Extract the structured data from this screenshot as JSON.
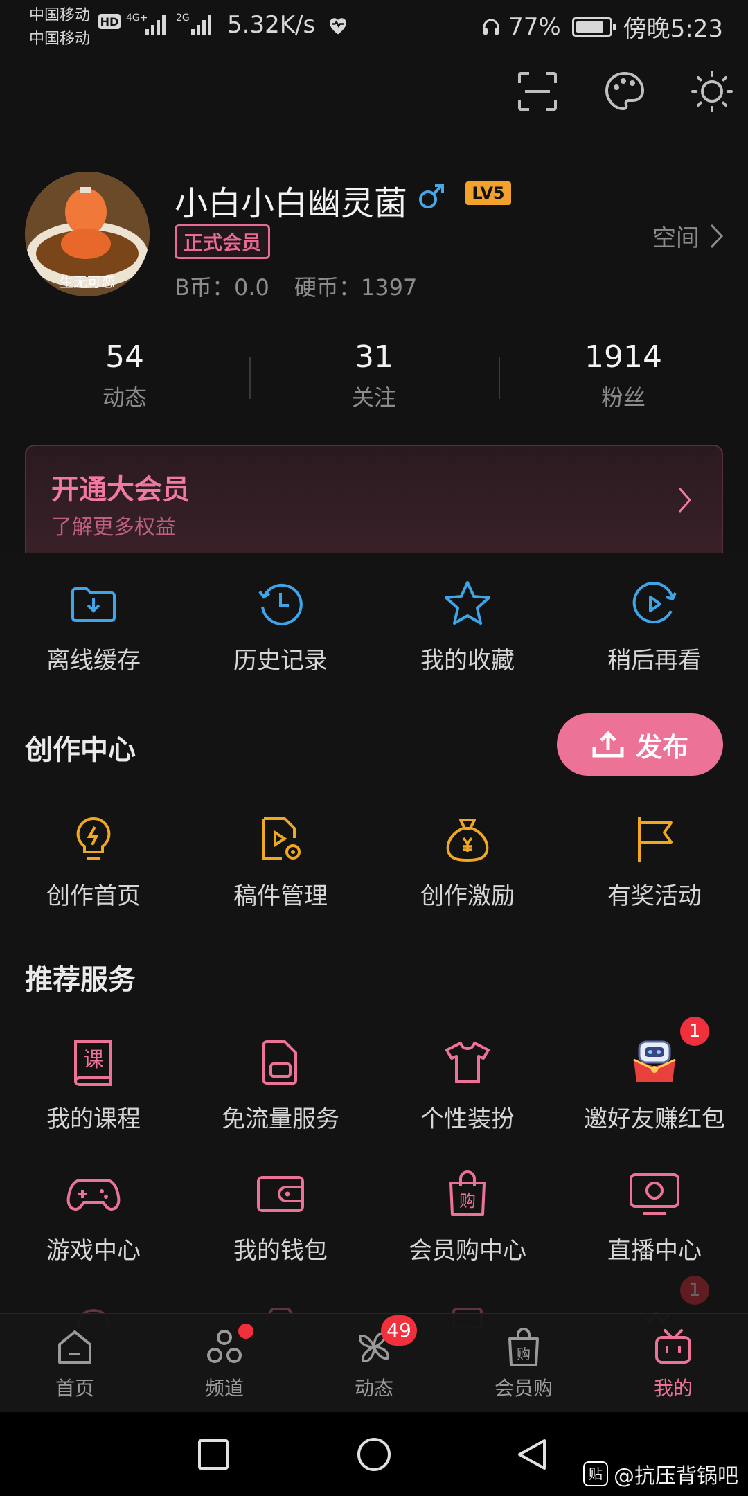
{
  "status_bar": {
    "carrier1": "中国移动",
    "carrier2": "中国移动",
    "hd": "HD",
    "net1": "4G+",
    "net2": "2G",
    "net_speed": "5.32K/s",
    "battery": "77%",
    "time": "傍晚5:23"
  },
  "profile": {
    "avatar_caption": "生无可恋",
    "username": "小白小白幽灵菌",
    "level": "LV5",
    "vip_badge": "正式会员",
    "b_coin": "B币：0.0",
    "hard_coin": "硬币：1397",
    "space_link": "空间"
  },
  "stats": [
    {
      "value": "54",
      "label": "动态"
    },
    {
      "value": "31",
      "label": "关注"
    },
    {
      "value": "1914",
      "label": "粉丝"
    }
  ],
  "vip_card": {
    "title": "开通大会员",
    "subtitle": "了解更多权益"
  },
  "quick_actions": [
    {
      "label": "离线缓存",
      "icon": "download-folder-icon"
    },
    {
      "label": "历史记录",
      "icon": "history-clock-icon"
    },
    {
      "label": "我的收藏",
      "icon": "star-icon"
    },
    {
      "label": "稍后再看",
      "icon": "watch-later-icon"
    }
  ],
  "creation": {
    "title": "创作中心",
    "publish_label": "发布",
    "items": [
      {
        "label": "创作首页",
        "icon": "lightbulb-icon"
      },
      {
        "label": "稿件管理",
        "icon": "manuscript-icon"
      },
      {
        "label": "创作激励",
        "icon": "money-bag-icon"
      },
      {
        "label": "有奖活动",
        "icon": "flag-icon"
      }
    ]
  },
  "services": {
    "title": "推荐服务",
    "row1": [
      {
        "label": "我的课程",
        "icon": "course-book-icon",
        "icon_text": "课"
      },
      {
        "label": "免流量服务",
        "icon": "sim-card-icon"
      },
      {
        "label": "个性装扮",
        "icon": "tshirt-icon"
      },
      {
        "label": "邀好友赚红包",
        "icon": "red-envelope-mascot-icon",
        "badge": "1"
      }
    ],
    "row2": [
      {
        "label": "游戏中心",
        "icon": "gamepad-icon"
      },
      {
        "label": "我的钱包",
        "icon": "wallet-icon"
      },
      {
        "label": "会员购中心",
        "icon": "shopping-bag-icon",
        "icon_text": "购"
      },
      {
        "label": "直播中心",
        "icon": "live-tv-icon"
      }
    ],
    "row3_badge": "1"
  },
  "tab_bar": [
    {
      "label": "首页",
      "icon": "home-icon"
    },
    {
      "label": "频道",
      "icon": "channel-icon"
    },
    {
      "label": "动态",
      "icon": "pinwheel-icon",
      "badge": "49"
    },
    {
      "label": "会员购",
      "icon": "shopping-bag-icon",
      "icon_text": "购"
    },
    {
      "label": "我的",
      "icon": "tv-mascot-icon"
    }
  ],
  "watermark": {
    "logo": "贴",
    "text": "@抗压背锅吧"
  },
  "colors": {
    "accent_pink": "#ec7396",
    "icon_blue": "#3ea6e8",
    "icon_orange": "#f0a820",
    "badge_red": "#f0313d",
    "background": "#121212"
  }
}
